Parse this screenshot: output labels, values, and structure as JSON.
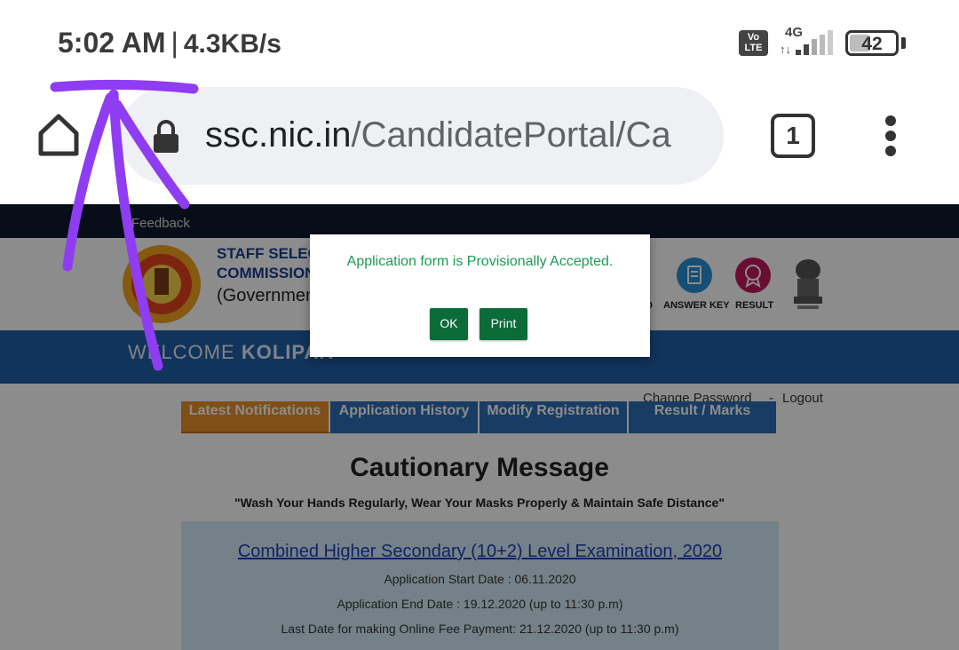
{
  "status_bar": {
    "time": "5:02 AM",
    "separator": "|",
    "net_speed": "4.3KB/s",
    "volte": "Vo\nLTE",
    "network": "4G",
    "arrows": "↑↓",
    "battery": "42",
    "battery_level": 0.42
  },
  "browser": {
    "url_host": "ssc.nic.in",
    "url_path": "/CandidatePortal/Ca",
    "tab_count": "1"
  },
  "page": {
    "feedback": "Feedback",
    "org_line1": "STAFF SELEC",
    "org_line2": "COMMISSION",
    "org_line3": "(Governmen",
    "nav_items": [
      {
        "label": "ANSWER KEY",
        "color": "#2a8fd6"
      },
      {
        "label": "RESULT",
        "color": "#c2185b"
      }
    ],
    "nav_partial": "D",
    "welcome_prefix": "WELCOME",
    "welcome_name": "KOLIPAK",
    "change_password": "Change Password",
    "dash": "-",
    "logout": "Logout",
    "tabs": [
      "Latest Notifications",
      "Application History",
      "Modify Registration",
      "Result / Marks"
    ],
    "caution_title": "Cautionary Message",
    "caution_sub": "\"Wash Your Hands Regularly, Wear Your Masks Properly & Maintain Safe Distance\"",
    "exam_title": "Combined Higher Secondary (10+2) Level Examination, 2020",
    "exam_lines": [
      "Application Start Date : 06.11.2020",
      "Application End Date : 19.12.2020 (up to 11:30 p.m)",
      "Last Date for making Online Fee Payment: 21.12.2020 (up to 11:30 p.m)"
    ]
  },
  "modal": {
    "message": "Application form is Provisionally Accepted.",
    "ok_label": "OK",
    "print_label": "Print"
  },
  "colors": {
    "annotation": "#8f3df2",
    "modal_button": "#0b6b39",
    "modal_text": "#1e9a55",
    "welcome_bar": "#1f5fa8"
  }
}
